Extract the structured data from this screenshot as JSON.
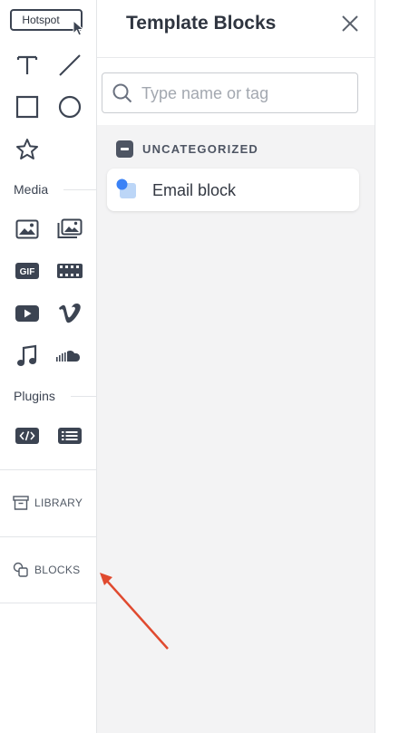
{
  "toolbar": {
    "hotspot_label": "Hotspot",
    "media_label": "Media",
    "plugins_label": "Plugins",
    "library_label": "LIBRARY",
    "blocks_label": "BLOCKS",
    "tools": [
      "text-icon",
      "line-icon",
      "rectangle-icon",
      "circle-icon",
      "star-icon",
      "image-icon",
      "gallery-icon",
      "gif-icon",
      "video-film-icon",
      "youtube-icon",
      "vimeo-icon",
      "music-icon",
      "soundcloud-icon",
      "code-embed-icon",
      "list-icon"
    ],
    "gif_text": "GIF"
  },
  "panel": {
    "title": "Template Blocks",
    "search_placeholder": "Type name or tag",
    "category_label": "UNCATEGORIZED",
    "blocks": [
      {
        "name": "Email block"
      }
    ]
  },
  "annotation": {
    "arrow_color": "#e04a2f"
  },
  "colors": {
    "icon": "#3c4452",
    "accent_blue": "#3b82f6",
    "light_blue": "#bcd6f7"
  }
}
